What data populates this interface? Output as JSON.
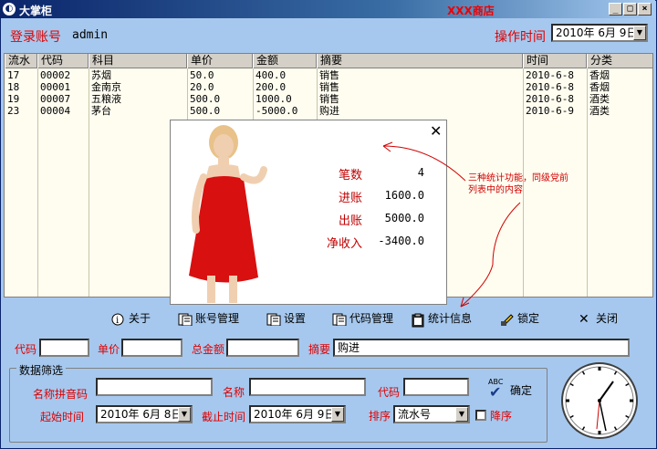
{
  "window": {
    "title": "大掌柜",
    "shop_name": "XXX商店"
  },
  "header": {
    "login_label": "登录账号",
    "login_value": "admin",
    "time_label": "操作时间",
    "time_value": "2010年 6月 9日"
  },
  "table": {
    "columns": [
      "流水",
      "代码",
      "科目",
      "单价",
      "金额",
      "摘要",
      "时间",
      "分类"
    ],
    "rows": [
      [
        "17",
        "00002",
        "苏烟",
        "50.0",
        "400.0",
        "销售",
        "2010-6-8",
        "香烟"
      ],
      [
        "18",
        "00001",
        "金南京",
        "20.0",
        "200.0",
        "销售",
        "2010-6-8",
        "香烟"
      ],
      [
        "19",
        "00007",
        "五粮液",
        "500.0",
        "1000.0",
        "销售",
        "2010-6-8",
        "酒类"
      ],
      [
        "23",
        "00004",
        "茅台",
        "500.0",
        "-5000.0",
        "购进",
        "2010-6-9",
        "酒类"
      ]
    ]
  },
  "stats": {
    "count_label": "笔数",
    "count_value": "4",
    "in_label": "进账",
    "in_value": "1600.0",
    "out_label": "出账",
    "out_value": "5000.0",
    "net_label": "净收入",
    "net_value": "-3400.0",
    "close": "✕"
  },
  "annotation": "三种统计功能，同级党前列表中的内容",
  "toolbar": {
    "about": "关于",
    "account": "账号管理",
    "settings": "设置",
    "code_mgmt": "代码管理",
    "stats": "统计信息",
    "lock": "锁定",
    "close": "关闭"
  },
  "form": {
    "code_label": "代码",
    "price_label": "单价",
    "total_label": "总金额",
    "summary_label": "摘要",
    "summary_value": "购进"
  },
  "filter": {
    "group_title": "数据筛选",
    "pinyin_label": "名称拼音码",
    "name_label": "名称",
    "code_label": "代码",
    "confirm": "确定",
    "abc": "ABC",
    "start_label": "起始时间",
    "start_value": "2010年 6月 8日",
    "end_label": "截止时间",
    "end_value": "2010年 6月 9日",
    "sort_label": "排序",
    "sort_value": "流水号",
    "desc_label": "降序"
  },
  "colors": {
    "accent_red": "#e00000",
    "panel_blue": "#a6c8ee"
  }
}
